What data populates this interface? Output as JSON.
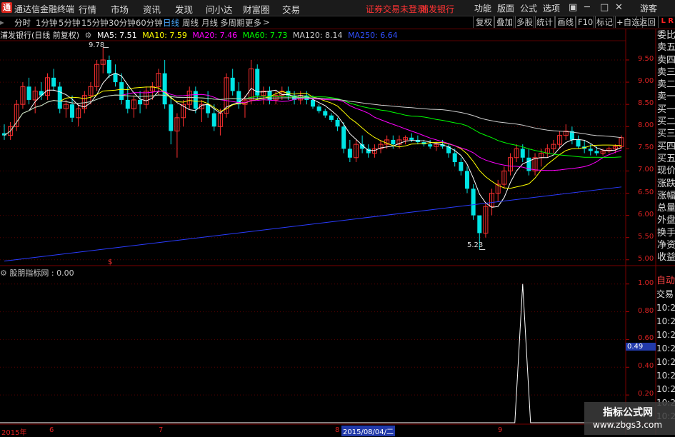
{
  "app": {
    "title": "通达信金融终端",
    "logo": "通"
  },
  "menu": [
    "行情",
    "市场",
    "资讯",
    "发现",
    "问小达",
    "财富圈",
    "交易"
  ],
  "status": {
    "trade": "证券交易未登录",
    "stock": "浦发银行"
  },
  "right_menu": [
    "功能",
    "版面",
    "公式",
    "选项"
  ],
  "user": "游客",
  "periods": [
    "分时",
    "1分钟",
    "5分钟",
    "15分钟",
    "30分钟",
    "60分钟",
    "日线",
    "周线",
    "月线",
    "多周期",
    "更多"
  ],
  "active_period": "日线",
  "tool_buttons": [
    "复权",
    "叠加",
    "多股",
    "统计",
    "画线",
    "F10",
    "标记",
    "+自选",
    "返回"
  ],
  "l_chip": "L R",
  "chart_header": {
    "name": "浦发银行(日线 前复权)",
    "ma": [
      {
        "label": "MA5: 7.51",
        "color": "#ffffff"
      },
      {
        "label": "MA10: 7.59",
        "color": "#ffff00"
      },
      {
        "label": "MA20: 7.46",
        "color": "#ff00ff"
      },
      {
        "label": "MA60: 7.73",
        "color": "#00ff00"
      },
      {
        "label": "MA120: 8.14",
        "color": "#cccccc"
      },
      {
        "label": "MA250: 6.64",
        "color": "#3050ff"
      }
    ]
  },
  "side_labels": [
    "委比",
    "卖五",
    "卖四",
    "卖三",
    "卖二",
    "卖一",
    "买一",
    "买二",
    "买三",
    "买四",
    "买五",
    "现价",
    "涨跌",
    "涨幅",
    "总量",
    "外盘",
    "换手",
    "净资",
    "收益"
  ],
  "side_labels2": [
    "自动",
    "交易",
    "10:2",
    "10:2",
    "10:2",
    "10:2",
    "10:2",
    "10:2",
    "10:2",
    "10:2",
    "10:2"
  ],
  "price_axis": [
    "9.50",
    "9.00",
    "8.50",
    "8.00",
    "7.50",
    "7.00",
    "6.50",
    "6.00",
    "5.50",
    "5.00"
  ],
  "ind_axis": [
    "1.00",
    "0.80",
    "0.60",
    "0.40",
    "0.20"
  ],
  "indicator": {
    "name": "股朋指标网 : 0.00",
    "value_cursor": "0.49"
  },
  "annotations": {
    "high": "9.78",
    "low": "5.23",
    "marker": "$"
  },
  "dates": {
    "year": "2015年",
    "m6": "6",
    "m7": "7",
    "m8": "8",
    "cursor": "2015/08/04/二",
    "m9": "9"
  },
  "watermark": {
    "line1": "指标公式网",
    "line2": "www.zbgs3.com"
  },
  "colors": {
    "up": "#ff3030",
    "down": "#00e5e5",
    "grid": "#5a0000"
  },
  "chart_data": {
    "type": "candlestick",
    "price_axis_range": [
      4.9,
      9.95
    ],
    "candles": [
      [
        7.85,
        8.05,
        7.7,
        7.8
      ],
      [
        7.8,
        8.1,
        7.7,
        8.0
      ],
      [
        8.0,
        8.6,
        7.9,
        8.5
      ],
      [
        8.5,
        9.0,
        8.4,
        8.9
      ],
      [
        8.9,
        9.1,
        8.5,
        8.6
      ],
      [
        8.6,
        8.9,
        8.3,
        8.8
      ],
      [
        8.8,
        9.0,
        8.6,
        8.7
      ],
      [
        8.7,
        9.2,
        8.6,
        9.1
      ],
      [
        9.1,
        9.3,
        8.8,
        8.9
      ],
      [
        8.9,
        9.0,
        8.3,
        8.4
      ],
      [
        8.4,
        8.6,
        8.2,
        8.5
      ],
      [
        8.5,
        8.7,
        8.1,
        8.2
      ],
      [
        8.2,
        8.5,
        8.0,
        8.4
      ],
      [
        8.4,
        8.8,
        8.3,
        8.7
      ],
      [
        8.7,
        9.0,
        8.5,
        8.9
      ],
      [
        8.9,
        9.5,
        8.8,
        9.4
      ],
      [
        9.4,
        9.78,
        9.2,
        9.5
      ],
      [
        9.5,
        9.6,
        9.1,
        9.2
      ],
      [
        9.2,
        9.4,
        8.9,
        9.0
      ],
      [
        9.0,
        9.2,
        8.5,
        8.6
      ],
      [
        8.6,
        8.9,
        8.3,
        8.4
      ],
      [
        8.4,
        8.7,
        8.2,
        8.6
      ],
      [
        8.6,
        8.8,
        8.3,
        8.5
      ],
      [
        8.5,
        8.9,
        8.4,
        8.8
      ],
      [
        8.8,
        9.0,
        8.6,
        8.9
      ],
      [
        8.9,
        9.3,
        8.7,
        9.2
      ],
      [
        9.2,
        9.5,
        8.4,
        8.5
      ],
      [
        8.5,
        8.7,
        7.6,
        7.9
      ],
      [
        7.9,
        8.3,
        7.3,
        8.2
      ],
      [
        8.2,
        8.6,
        8.0,
        8.5
      ],
      [
        8.5,
        8.9,
        8.4,
        8.8
      ],
      [
        8.8,
        8.9,
        8.3,
        8.4
      ],
      [
        8.4,
        8.6,
        8.1,
        8.5
      ],
      [
        8.5,
        8.8,
        8.2,
        8.3
      ],
      [
        8.3,
        8.5,
        7.9,
        8.0
      ],
      [
        8.0,
        8.4,
        7.8,
        8.3
      ],
      [
        8.3,
        9.2,
        8.2,
        9.1
      ],
      [
        9.1,
        9.3,
        8.7,
        8.8
      ],
      [
        8.8,
        9.0,
        8.4,
        8.5
      ],
      [
        8.5,
        8.7,
        8.2,
        8.6
      ],
      [
        8.6,
        9.5,
        8.5,
        9.3
      ],
      [
        9.3,
        9.4,
        8.6,
        8.7
      ],
      [
        8.7,
        8.9,
        8.5,
        8.8
      ],
      [
        8.8,
        8.9,
        8.5,
        8.6
      ],
      [
        8.6,
        8.8,
        8.5,
        8.7
      ],
      [
        8.7,
        8.9,
        8.6,
        8.8
      ],
      [
        8.8,
        8.9,
        8.6,
        8.7
      ],
      [
        8.7,
        8.8,
        8.5,
        8.6
      ],
      [
        8.6,
        8.8,
        8.5,
        8.7
      ],
      [
        8.7,
        8.8,
        8.5,
        8.6
      ],
      [
        8.6,
        8.7,
        8.4,
        8.45
      ],
      [
        8.45,
        8.5,
        8.3,
        8.35
      ],
      [
        8.35,
        8.4,
        8.2,
        8.25
      ],
      [
        8.25,
        8.3,
        8.1,
        8.15
      ],
      [
        8.15,
        8.2,
        7.9,
        8.0
      ],
      [
        8.0,
        8.1,
        7.4,
        7.5
      ],
      [
        7.5,
        7.7,
        7.2,
        7.3
      ],
      [
        7.3,
        7.7,
        7.2,
        7.6
      ],
      [
        7.6,
        7.8,
        7.4,
        7.5
      ],
      [
        7.5,
        7.6,
        7.3,
        7.4
      ],
      [
        7.4,
        7.6,
        7.3,
        7.5
      ],
      [
        7.5,
        7.7,
        7.4,
        7.6
      ],
      [
        7.6,
        7.8,
        7.5,
        7.7
      ],
      [
        7.7,
        7.8,
        7.5,
        7.6
      ],
      [
        7.6,
        7.8,
        7.5,
        7.7
      ],
      [
        7.7,
        7.8,
        7.6,
        7.75
      ],
      [
        7.75,
        7.85,
        7.65,
        7.7
      ],
      [
        7.7,
        7.8,
        7.6,
        7.65
      ],
      [
        7.65,
        7.7,
        7.55,
        7.6
      ],
      [
        7.6,
        7.7,
        7.5,
        7.55
      ],
      [
        7.55,
        7.65,
        7.45,
        7.6
      ],
      [
        7.6,
        7.7,
        7.5,
        7.55
      ],
      [
        7.55,
        7.6,
        7.3,
        7.4
      ],
      [
        7.4,
        7.5,
        7.1,
        7.2
      ],
      [
        7.2,
        7.3,
        6.9,
        7.0
      ],
      [
        7.0,
        7.1,
        6.5,
        6.6
      ],
      [
        6.6,
        6.7,
        5.9,
        6.0
      ],
      [
        6.0,
        5.9,
        5.23,
        5.6
      ],
      [
        5.6,
        6.3,
        5.5,
        6.2
      ],
      [
        6.2,
        6.6,
        6.0,
        6.5
      ],
      [
        6.5,
        6.8,
        6.3,
        6.7
      ],
      [
        6.7,
        7.1,
        6.6,
        7.0
      ],
      [
        7.0,
        7.4,
        6.9,
        7.3
      ],
      [
        7.3,
        7.6,
        7.2,
        7.5
      ],
      [
        7.5,
        7.6,
        7.2,
        7.3
      ],
      [
        7.3,
        7.5,
        6.9,
        7.0
      ],
      [
        7.0,
        7.4,
        6.9,
        7.3
      ],
      [
        7.3,
        7.5,
        7.1,
        7.4
      ],
      [
        7.4,
        7.6,
        7.3,
        7.5
      ],
      [
        7.5,
        7.7,
        7.4,
        7.6
      ],
      [
        7.6,
        7.9,
        7.5,
        7.8
      ],
      [
        7.8,
        8.05,
        7.7,
        7.9
      ],
      [
        7.9,
        8.0,
        7.6,
        7.7
      ],
      [
        7.7,
        7.8,
        7.5,
        7.55
      ],
      [
        7.55,
        7.7,
        7.4,
        7.5
      ],
      [
        7.5,
        7.6,
        7.35,
        7.45
      ],
      [
        7.45,
        7.55,
        7.35,
        7.4
      ],
      [
        7.4,
        7.5,
        7.35,
        7.45
      ],
      [
        7.45,
        7.55,
        7.4,
        7.5
      ],
      [
        7.5,
        7.6,
        7.4,
        7.55
      ],
      [
        7.55,
        7.8,
        7.5,
        7.75
      ]
    ],
    "ma250_line": [
      [
        0,
        4.97
      ],
      [
        100,
        6.64
      ]
    ],
    "indicator_pulse_index": 84,
    "indicator_range": [
      0,
      1.05
    ]
  }
}
